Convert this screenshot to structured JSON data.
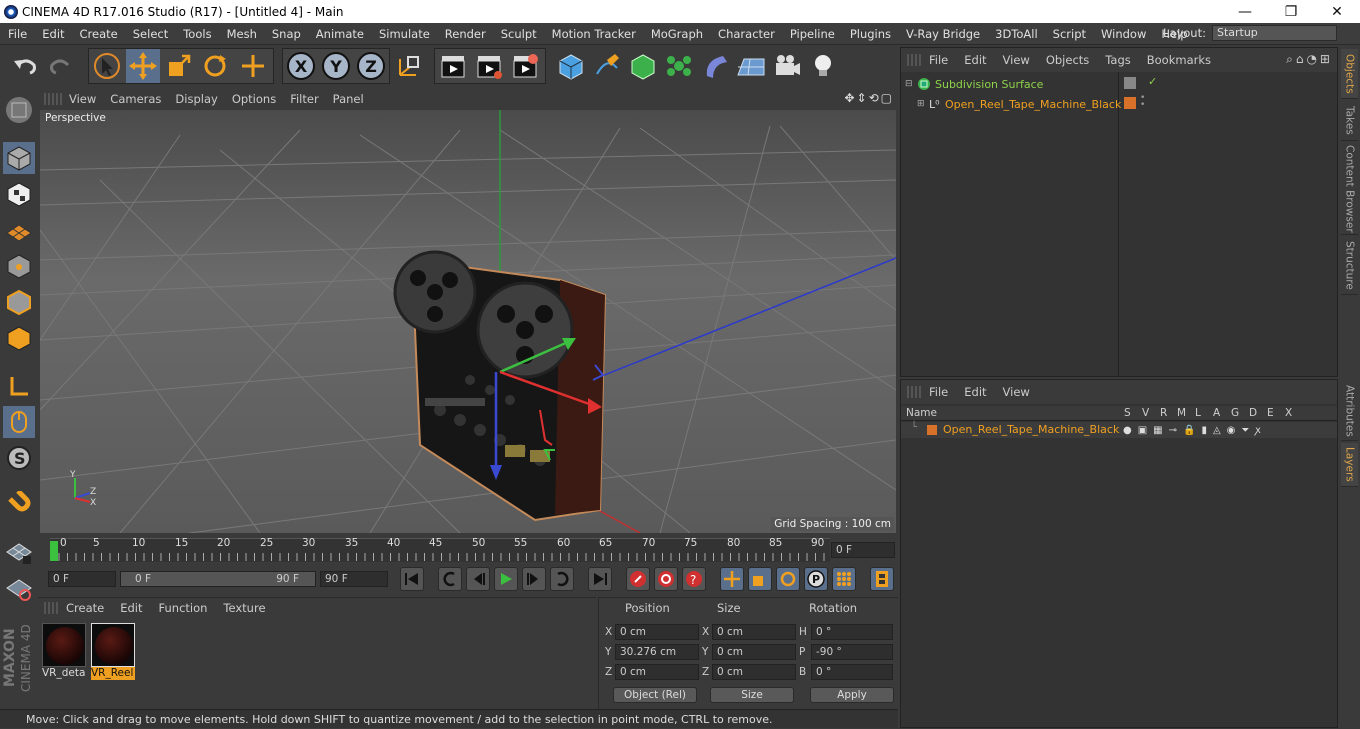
{
  "window": {
    "title": "CINEMA 4D R17.016 Studio (R17) - [Untitled 4] - Main",
    "minimize": "—",
    "maximize": "❐",
    "close": "✕"
  },
  "menu": [
    "File",
    "Edit",
    "Create",
    "Select",
    "Tools",
    "Mesh",
    "Snap",
    "Animate",
    "Simulate",
    "Render",
    "Sculpt",
    "Motion Tracker",
    "MoGraph",
    "Character",
    "Pipeline",
    "Plugins",
    "V-Ray Bridge",
    "3DToAll",
    "Script",
    "Window",
    "Help"
  ],
  "layout": {
    "label": "Layout:",
    "value": "Startup"
  },
  "toolbar": {
    "axes": [
      "X",
      "Y",
      "Z"
    ]
  },
  "viewport": {
    "menu": [
      "View",
      "Cameras",
      "Display",
      "Options",
      "Filter",
      "Panel"
    ],
    "label": "Perspective",
    "grid_spacing": "Grid Spacing : 100 cm",
    "axis_y": "Y",
    "axis_z": "Z",
    "axis_x": "X"
  },
  "timeline": {
    "ticks": [
      "0",
      "5",
      "10",
      "15",
      "20",
      "25",
      "30",
      "35",
      "40",
      "45",
      "50",
      "55",
      "60",
      "65",
      "70",
      "75",
      "80",
      "85",
      "90"
    ],
    "current_frame": "0 F"
  },
  "transport": {
    "start": "0 F",
    "range_start": "0 F",
    "range_end": "90 F",
    "end": "90 F"
  },
  "material": {
    "menu": [
      "Create",
      "Edit",
      "Function",
      "Texture"
    ],
    "items": [
      "VR_deta",
      "VR_Reel"
    ]
  },
  "coords": {
    "headers": [
      "Position",
      "Size",
      "Rotation"
    ],
    "rows": [
      {
        "pl": "X",
        "pos": "0 cm",
        "sl": "X",
        "size": "0 cm",
        "rl": "H",
        "rot": "0 °"
      },
      {
        "pl": "Y",
        "pos": "30.276 cm",
        "sl": "Y",
        "size": "0 cm",
        "rl": "P",
        "rot": "-90 °"
      },
      {
        "pl": "Z",
        "pos": "0 cm",
        "sl": "Z",
        "size": "0 cm",
        "rl": "B",
        "rot": "0 °"
      }
    ],
    "mode": "Object (Rel)",
    "size_mode": "Size",
    "apply": "Apply"
  },
  "status": "Move: Click and drag to move elements. Hold down SHIFT to quantize movement / add to the selection in point mode, CTRL to remove.",
  "objects": {
    "menu": [
      "File",
      "Edit",
      "View",
      "Objects",
      "Tags",
      "Bookmarks"
    ],
    "items": [
      "Subdivision Surface",
      "Open_Reel_Tape_Machine_Black"
    ]
  },
  "layers": {
    "menu": [
      "File",
      "Edit",
      "View"
    ],
    "header_name": "Name",
    "cols": [
      "S",
      "V",
      "R",
      "M",
      "L",
      "A",
      "G",
      "D",
      "E",
      "X"
    ],
    "item": "Open_Reel_Tape_Machine_Black"
  },
  "side_tabs": [
    "Objects",
    "Takes",
    "Content Browser",
    "Structure",
    "Attributes",
    "Layers"
  ],
  "logo": {
    "line1": "MAXON",
    "line2": "CINEMA 4D"
  }
}
